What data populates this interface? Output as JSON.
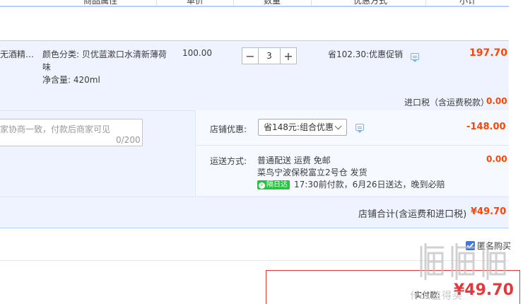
{
  "header": {
    "columns": [
      "商品属性",
      "单价",
      "数量",
      "优惠方式",
      "小计"
    ]
  },
  "item": {
    "title": "无酒精便...",
    "sku": [
      "颜色分类: 贝优蓝漱口水清新薄荷",
      "味",
      "净含量: 420ml"
    ],
    "unit_price": "100.00",
    "quantity": "3",
    "minus_label": "−",
    "plus_label": "+",
    "promo": "省102.30:优惠促销",
    "subtotal": "197.70",
    "tax_label": "进口税（含运费税款）",
    "tax_value": "0.00"
  },
  "message": {
    "placeholder": "家协商一致，付款后商家可见",
    "counter": "0/200"
  },
  "shop_discount": {
    "label": "店铺优惠:",
    "selected": "省148元:组合优惠",
    "value": "-148.00"
  },
  "shipping": {
    "label": "运送方式:",
    "method": "普通配送 运费 免邮",
    "warehouse": "菜鸟宁波保税富立2号仓   发货",
    "badge": "隔日达",
    "badge_color": "#27c53f",
    "note": "17:30前付款，6月26日送达，晚到必赔",
    "value": "0.00"
  },
  "shop_total": {
    "label": "店铺合计(含运费和进口税)",
    "value": "¥49.70"
  },
  "anonymous": {
    "label": "匿名购买",
    "checked": true
  },
  "payment": {
    "label": "实付款:",
    "value": "¥49.70"
  },
  "watermark": {
    "text": "什么值得买"
  },
  "colors": {
    "accent_red": "#ff4400",
    "pay_red": "#e4393c",
    "header_blue": "#b2d1ff",
    "row_bg": "#eef3ff"
  }
}
